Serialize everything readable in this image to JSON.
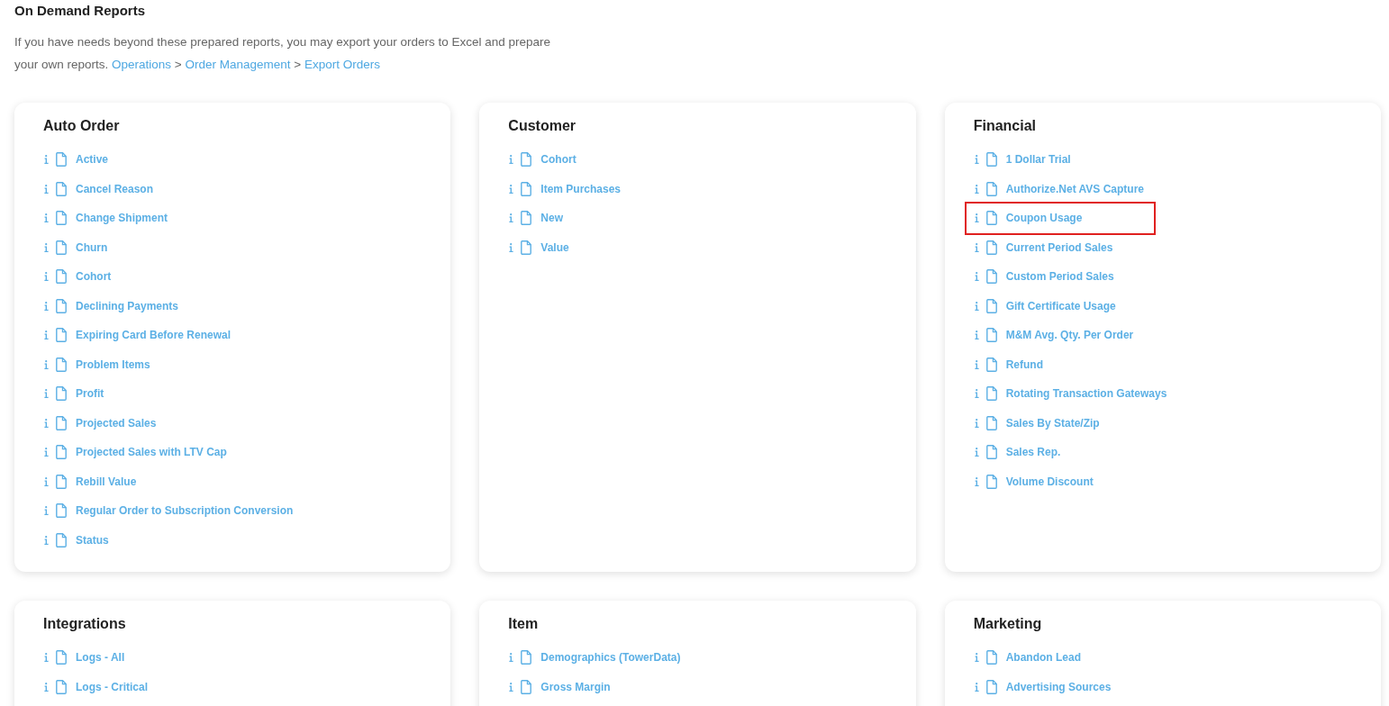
{
  "page": {
    "title": "On Demand Reports"
  },
  "intro": {
    "text": "If you have needs beyond these prepared reports, you may export your orders to Excel and prepare your own reports.",
    "breadcrumb": [
      {
        "kind": "link",
        "label": "Operations"
      },
      {
        "kind": "separator",
        "label": ">"
      },
      {
        "kind": "link",
        "label": "Order Management"
      },
      {
        "kind": "separator",
        "label": ">"
      },
      {
        "kind": "link",
        "label": "Export Orders"
      }
    ]
  },
  "sections": [
    {
      "title": "Auto Order",
      "reports": [
        {
          "label": "Active",
          "highlighted": false
        },
        {
          "label": "Cancel Reason",
          "highlighted": false
        },
        {
          "label": "Change Shipment",
          "highlighted": false
        },
        {
          "label": "Churn",
          "highlighted": false
        },
        {
          "label": "Cohort",
          "highlighted": false
        },
        {
          "label": "Declining Payments",
          "highlighted": false
        },
        {
          "label": "Expiring Card Before Renewal",
          "highlighted": false
        },
        {
          "label": "Problem Items",
          "highlighted": false
        },
        {
          "label": "Profit",
          "highlighted": false
        },
        {
          "label": "Projected Sales",
          "highlighted": false
        },
        {
          "label": "Projected Sales with LTV Cap",
          "highlighted": false
        },
        {
          "label": "Rebill Value",
          "highlighted": false
        },
        {
          "label": "Regular Order to Subscription Conversion",
          "highlighted": false
        },
        {
          "label": "Status",
          "highlighted": false
        }
      ]
    },
    {
      "title": "Customer",
      "reports": [
        {
          "label": "Cohort",
          "highlighted": false
        },
        {
          "label": "Item Purchases",
          "highlighted": false
        },
        {
          "label": "New",
          "highlighted": false
        },
        {
          "label": "Value",
          "highlighted": false
        }
      ]
    },
    {
      "title": "Financial",
      "reports": [
        {
          "label": "1 Dollar Trial",
          "highlighted": false
        },
        {
          "label": "Authorize.Net AVS Capture",
          "highlighted": false
        },
        {
          "label": "Coupon Usage",
          "highlighted": true
        },
        {
          "label": "Current Period Sales",
          "highlighted": false
        },
        {
          "label": "Custom Period Sales",
          "highlighted": false
        },
        {
          "label": "Gift Certificate Usage",
          "highlighted": false
        },
        {
          "label": "M&M Avg. Qty. Per Order",
          "highlighted": false
        },
        {
          "label": "Refund",
          "highlighted": false
        },
        {
          "label": "Rotating Transaction Gateways",
          "highlighted": false
        },
        {
          "label": "Sales By State/Zip",
          "highlighted": false
        },
        {
          "label": "Sales Rep.",
          "highlighted": false
        },
        {
          "label": "Volume Discount",
          "highlighted": false
        }
      ]
    },
    {
      "title": "Integrations",
      "reports": [
        {
          "label": "Logs - All",
          "highlighted": false
        },
        {
          "label": "Logs - Critical",
          "highlighted": false
        }
      ]
    },
    {
      "title": "Item",
      "reports": [
        {
          "label": "Demographics (TowerData)",
          "highlighted": false
        },
        {
          "label": "Gross Margin",
          "highlighted": false
        }
      ]
    },
    {
      "title": "Marketing",
      "reports": [
        {
          "label": "Abandon Lead",
          "highlighted": false
        },
        {
          "label": "Advertising Sources",
          "highlighted": false
        }
      ]
    }
  ]
}
